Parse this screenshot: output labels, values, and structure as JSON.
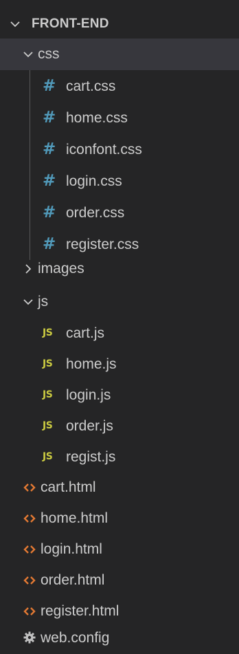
{
  "explorer": {
    "root": {
      "label": "FRONT-END",
      "expanded": true
    },
    "folders": {
      "css": {
        "label": "css",
        "expanded": true
      },
      "images": {
        "label": "images",
        "expanded": false
      },
      "js": {
        "label": "js",
        "expanded": true
      }
    },
    "css_files": [
      {
        "label": "cart.css",
        "icon": "css-hash-icon"
      },
      {
        "label": "home.css",
        "icon": "css-hash-icon"
      },
      {
        "label": "iconfont.css",
        "icon": "css-hash-icon"
      },
      {
        "label": "login.css",
        "icon": "css-hash-icon"
      },
      {
        "label": "order.css",
        "icon": "css-hash-icon"
      },
      {
        "label": "register.css",
        "icon": "css-hash-icon"
      }
    ],
    "js_files": [
      {
        "label": "cart.js",
        "icon": "js-icon"
      },
      {
        "label": "home.js",
        "icon": "js-icon"
      },
      {
        "label": "login.js",
        "icon": "js-icon"
      },
      {
        "label": "order.js",
        "icon": "js-icon"
      },
      {
        "label": "regist.js",
        "icon": "js-icon"
      }
    ],
    "root_files": [
      {
        "label": "cart.html",
        "icon": "html-icon"
      },
      {
        "label": "home.html",
        "icon": "html-icon"
      },
      {
        "label": "login.html",
        "icon": "html-icon"
      },
      {
        "label": "order.html",
        "icon": "html-icon"
      },
      {
        "label": "register.html",
        "icon": "html-icon"
      },
      {
        "label": "web.config",
        "icon": "gear-icon"
      }
    ],
    "icon_text": {
      "css": "#",
      "js": "JS"
    },
    "colors": {
      "background": "#252526",
      "selected_row": "#37373d",
      "text": "#cccccc",
      "css_icon": "#519aba",
      "js_icon": "#cbcb41",
      "html_icon": "#e37933",
      "gear_icon": "#c0c0c0",
      "indent_guide": "#585858"
    }
  }
}
